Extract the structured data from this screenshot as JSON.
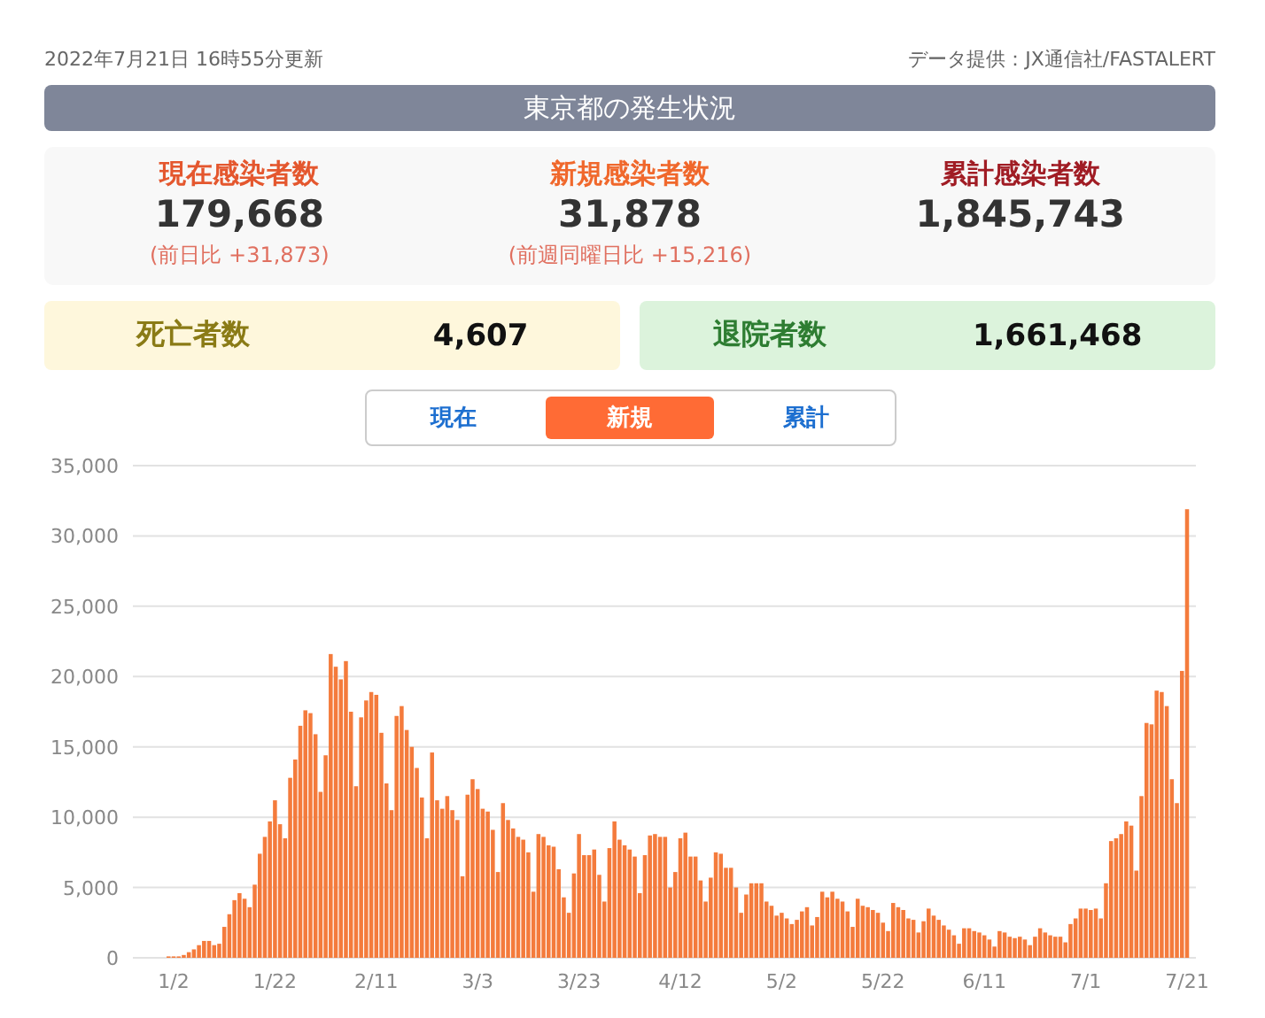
{
  "updated": "2022年7月21日 16時55分更新",
  "source": "データ提供：JX通信社/FASTALERT",
  "title": "東京都の発生状況",
  "stats": [
    {
      "kind": "current",
      "label": "現在感染者数",
      "value": "179,668",
      "note": "(前日比 +31,873)"
    },
    {
      "kind": "new",
      "label": "新規感染者数",
      "value": "31,878",
      "note": "(前週同曜日比 +15,216)"
    },
    {
      "kind": "total",
      "label": "累計感染者数",
      "value": "1,845,743"
    }
  ],
  "cards": [
    {
      "kind": "deaths",
      "label": "死亡者数",
      "value": "4,607"
    },
    {
      "kind": "recovered",
      "label": "退院者数",
      "value": "1,661,468"
    }
  ],
  "tabs": [
    {
      "label": "現在",
      "selected": false
    },
    {
      "label": "新規",
      "selected": true
    },
    {
      "label": "累計",
      "selected": false
    }
  ],
  "chart_data": {
    "type": "bar",
    "grid": true,
    "ylim": [
      0,
      35000
    ],
    "yticks": [
      {
        "value": 0,
        "label": "0"
      },
      {
        "value": 5000,
        "label": "5,000"
      },
      {
        "value": 10000,
        "label": "10,000"
      },
      {
        "value": 15000,
        "label": "15,000"
      },
      {
        "value": 20000,
        "label": "20,000"
      },
      {
        "value": 25000,
        "label": "25,000"
      },
      {
        "value": 30000,
        "label": "30,000"
      },
      {
        "value": 35000,
        "label": "35,000"
      }
    ],
    "categories": [
      null,
      "1/2",
      null,
      null,
      null,
      null,
      null,
      null,
      null,
      null,
      null,
      null,
      null,
      null,
      null,
      null,
      null,
      null,
      null,
      null,
      null,
      "1/22",
      null,
      null,
      null,
      null,
      null,
      null,
      null,
      null,
      null,
      null,
      null,
      null,
      null,
      null,
      null,
      null,
      null,
      null,
      null,
      "2/11",
      null,
      null,
      null,
      null,
      null,
      null,
      null,
      null,
      null,
      null,
      null,
      null,
      null,
      null,
      null,
      null,
      null,
      null,
      null,
      "3/3",
      null,
      null,
      null,
      null,
      null,
      null,
      null,
      null,
      null,
      null,
      null,
      null,
      null,
      null,
      null,
      null,
      null,
      null,
      null,
      "3/23",
      null,
      null,
      null,
      null,
      null,
      null,
      null,
      null,
      null,
      null,
      null,
      null,
      null,
      null,
      null,
      null,
      null,
      null,
      null,
      "4/12",
      null,
      null,
      null,
      null,
      null,
      null,
      null,
      null,
      null,
      null,
      null,
      null,
      null,
      null,
      null,
      null,
      null,
      null,
      null,
      "5/2",
      null,
      null,
      null,
      null,
      null,
      null,
      null,
      null,
      null,
      null,
      null,
      null,
      null,
      null,
      null,
      null,
      null,
      null,
      null,
      "5/22",
      null,
      null,
      null,
      null,
      null,
      null,
      null,
      null,
      null,
      null,
      null,
      null,
      null,
      null,
      null,
      null,
      null,
      null,
      null,
      "6/11",
      null,
      null,
      null,
      null,
      null,
      null,
      null,
      null,
      null,
      null,
      null,
      null,
      null,
      null,
      null,
      null,
      null,
      null,
      null,
      "7/1",
      null,
      null,
      null,
      null,
      null,
      null,
      null,
      null,
      null,
      null,
      null,
      null,
      null,
      null,
      null,
      null,
      null,
      null,
      null,
      "7/21"
    ],
    "series": [
      {
        "color": "#f47b3c",
        "values": [
          100,
          100,
          100,
          200,
          400,
          600,
          900,
          1200,
          1200,
          900,
          1000,
          2200,
          3100,
          4100,
          4600,
          4200,
          3600,
          5200,
          7400,
          8600,
          9700,
          11200,
          9500,
          8500,
          12800,
          14100,
          16500,
          17600,
          17400,
          15900,
          11800,
          14400,
          21600,
          20700,
          19800,
          21100,
          17500,
          12200,
          17100,
          18300,
          18900,
          18700,
          16000,
          12400,
          10500,
          17200,
          17900,
          16200,
          15000,
          13500,
          11400,
          8500,
          14600,
          11200,
          10600,
          11500,
          10500,
          9800,
          5800,
          11600,
          12700,
          12000,
          10600,
          10400,
          9100,
          6100,
          11000,
          9800,
          9200,
          8600,
          8400,
          7500,
          4700,
          8800,
          8600,
          8000,
          7900,
          6300,
          4300,
          3200,
          6000,
          8800,
          7300,
          7300,
          7700,
          5900,
          4000,
          7800,
          9700,
          8400,
          8000,
          7700,
          7200,
          4600,
          7300,
          8700,
          8800,
          8600,
          8600,
          5000,
          6100,
          8500,
          8900,
          7200,
          7200,
          5500,
          4000,
          5700,
          7500,
          7400,
          6400,
          6400,
          5000,
          3200,
          4500,
          5300,
          5300,
          5300,
          4000,
          3700,
          3000,
          3200,
          2800,
          2400,
          2700,
          3300,
          3600,
          2300,
          2900,
          4700,
          4300,
          4700,
          4200,
          4000,
          3300,
          2200,
          4200,
          3700,
          3600,
          3400,
          3200,
          2500,
          1900,
          3900,
          3600,
          3400,
          2800,
          2700,
          1800,
          2600,
          3500,
          3000,
          2700,
          2300,
          2000,
          1600,
          1000,
          2100,
          2100,
          1900,
          1800,
          1600,
          1300,
          800,
          1900,
          1800,
          1500,
          1400,
          1500,
          1300,
          900,
          1500,
          2100,
          1800,
          1600,
          1500,
          1500,
          1100,
          2400,
          2800,
          3500,
          3500,
          3400,
          3500,
          2800,
          5300,
          8300,
          8500,
          8800,
          9700,
          9400,
          6200,
          11500,
          16700,
          16600,
          19000,
          18900,
          17900,
          12700,
          11000,
          20400,
          31900
        ]
      }
    ]
  }
}
